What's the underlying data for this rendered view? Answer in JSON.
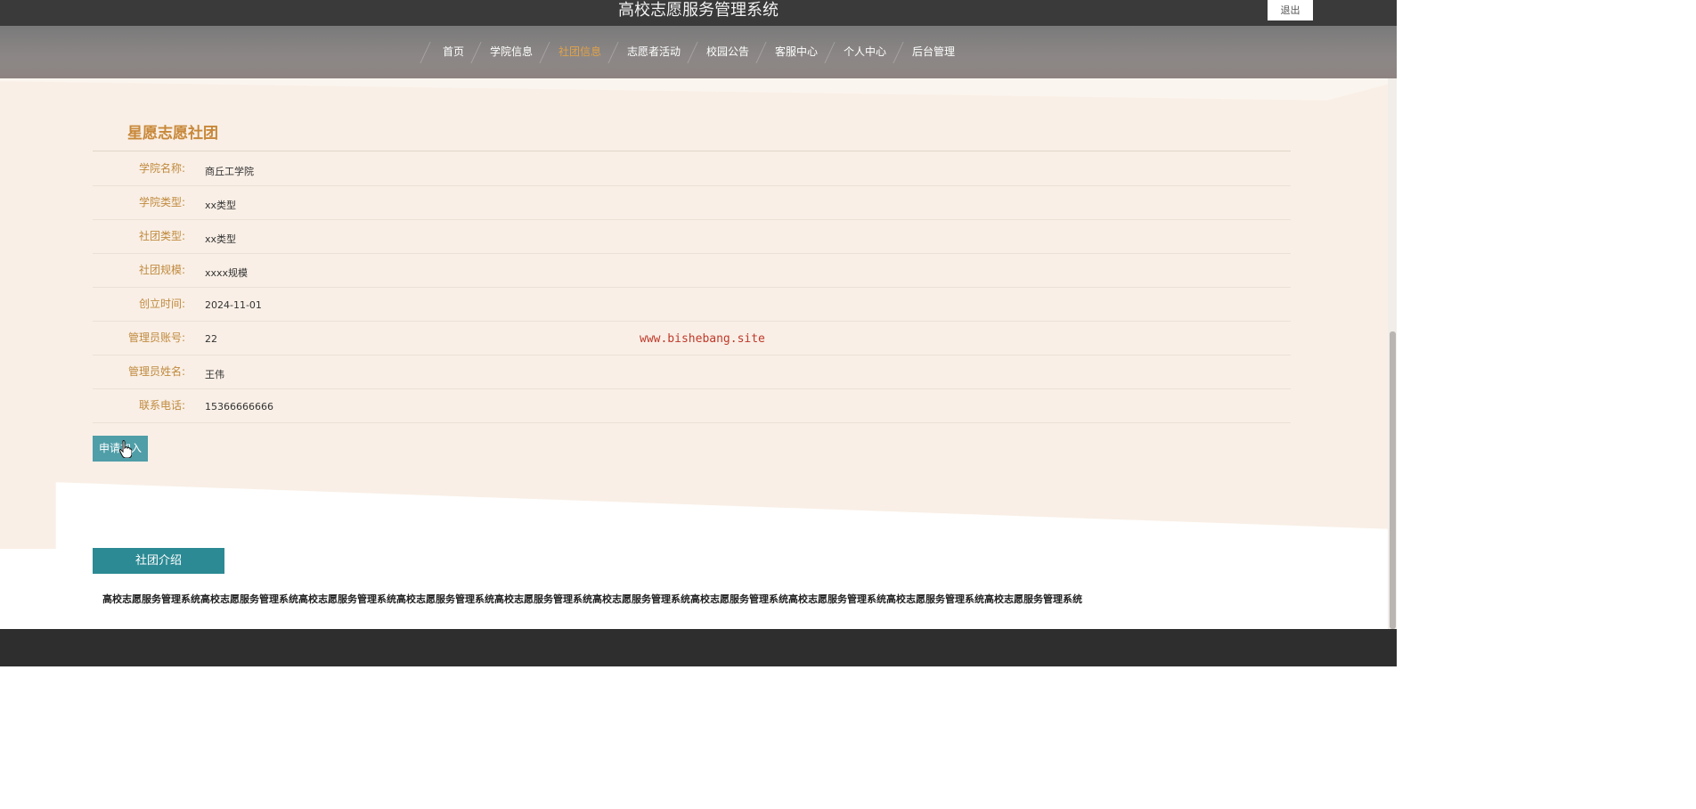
{
  "header": {
    "site_title": "高校志愿服务管理系统",
    "logout_label": "退出"
  },
  "nav": {
    "items": [
      {
        "label": "首页"
      },
      {
        "label": "学院信息"
      },
      {
        "label": "社团信息",
        "active": true
      },
      {
        "label": "志愿者活动"
      },
      {
        "label": "校园公告"
      },
      {
        "label": "客服中心"
      },
      {
        "label": "个人中心"
      },
      {
        "label": "后台管理"
      }
    ]
  },
  "club": {
    "title": "星愿志愿社团",
    "fields": [
      {
        "label": "学院名称:",
        "value": "商丘工学院"
      },
      {
        "label": "学院类型:",
        "value": "xx类型"
      },
      {
        "label": "社团类型:",
        "value": "xx类型"
      },
      {
        "label": "社团规模:",
        "value": "xxxx规模"
      },
      {
        "label": "创立时间:",
        "value": "2024-11-01"
      },
      {
        "label": "管理员账号:",
        "value": "22"
      },
      {
        "label": "管理员姓名:",
        "value": "王伟"
      },
      {
        "label": "联系电话:",
        "value": "15366666666"
      }
    ],
    "apply_label": "申请加入"
  },
  "watermark": "www.bishebang.site",
  "intro": {
    "tab_label": "社团介绍",
    "text": "高校志愿服务管理系统高校志愿服务管理系统高校志愿服务管理系统高校志愿服务管理系统高校志愿服务管理系统高校志愿服务管理系统高校志愿服务管理系统高校志愿服务管理系统高校志愿服务管理系统高校志愿服务管理系统"
  },
  "colors": {
    "accent": "#c8883a",
    "nav_active": "#e0a24a",
    "teal": "#2c8a94",
    "button": "#4f9ea8"
  }
}
